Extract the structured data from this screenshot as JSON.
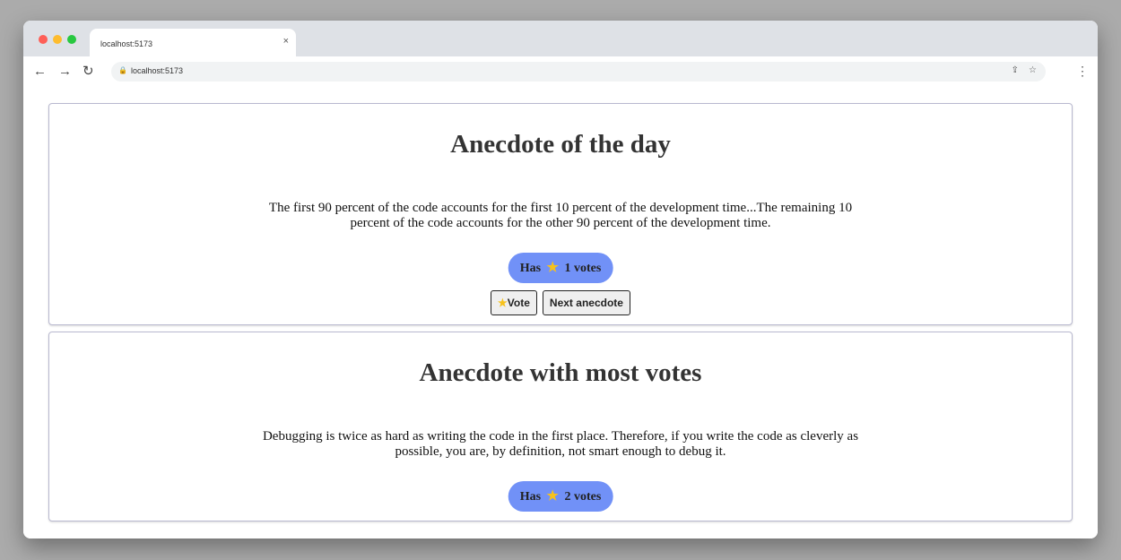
{
  "browser": {
    "tab_title": "localhost:5173",
    "tab_close": "×",
    "url": "localhost:5173",
    "icons": [
      "back-arrow-icon",
      "forward-arrow-icon",
      "reload-icon",
      "lock-icon",
      "share-icon",
      "bookmark-star-icon",
      "menu-dots-icon"
    ]
  },
  "anecdote_of_day": {
    "title": "Anecdote of the day",
    "text": "The first 90 percent of the code accounts for the first 10 percent of the development time...The remaining 10 percent of the code accounts for the other 90 percent of the development time.",
    "votes_prefix": "Has",
    "votes_suffix": "1 votes",
    "vote_button": "Vote",
    "next_button": "Next anecdote"
  },
  "most_votes": {
    "title": "Anecdote with most votes",
    "text": "Debugging is twice as hard as writing the code in the first place. Therefore, if you write the code as cleverly as possible, you are, by definition, not smart enough to debug it.",
    "votes_prefix": "Has",
    "votes_suffix": "2 votes"
  },
  "colors": {
    "vote_badge": "#7191f7",
    "star": "#f7c21b",
    "card_border": "#b9b9d0"
  }
}
